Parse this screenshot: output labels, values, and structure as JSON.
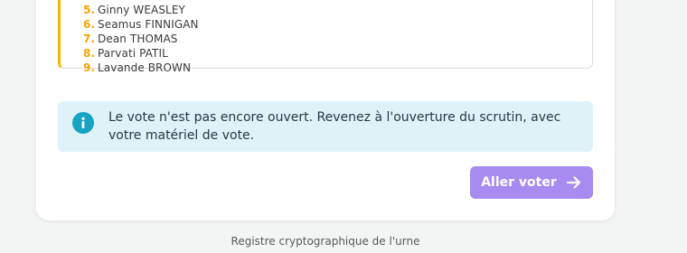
{
  "candidates": [
    {
      "num": "5.",
      "name": "Ginny WEASLEY"
    },
    {
      "num": "6.",
      "name": "Seamus FINNIGAN"
    },
    {
      "num": "7.",
      "name": "Dean THOMAS"
    },
    {
      "num": "8.",
      "name": "Parvati PATIL"
    },
    {
      "num": "9.",
      "name": "Lavande BROWN"
    }
  ],
  "info": {
    "icon": "info-icon",
    "message": "Le vote n'est pas encore ouvert. Revenez à l'ouverture du scrutin, avec votre matériel de vote."
  },
  "action": {
    "label": "Aller voter",
    "icon": "arrow-right-icon"
  },
  "footer": {
    "link": "Registre cryptographique de l'urne"
  },
  "colors": {
    "accent_number": "#f5a300",
    "list_border": "#f5b800",
    "info_bg": "#dff2f8",
    "info_icon": "#17a4c3",
    "button": "#a78bf0"
  }
}
